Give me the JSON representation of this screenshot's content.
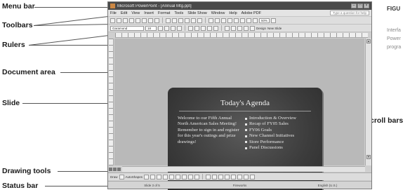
{
  "callouts": {
    "menu_bar": "Menu bar",
    "toolbars": "Toolbars",
    "rulers": "Rulers",
    "document_area": "Document area",
    "slide": "Slide",
    "drawing_tools": "Drawing tools",
    "status_bar": "Status bar",
    "scroll_bars": "Scroll bars"
  },
  "figure": {
    "label": "FIGU",
    "lines": [
      "Interfa",
      "Power",
      "progra"
    ]
  },
  "window": {
    "title": "Microsoft PowerPoint - [Annual Mtg.ppt]",
    "menu": [
      "File",
      "Edit",
      "View",
      "Insert",
      "Format",
      "Tools",
      "Slide Show",
      "Window",
      "Help",
      "Adobe PDF"
    ],
    "help_placeholder": "Type a question for help",
    "font_name": "Garamond",
    "font_size": "18",
    "zoom": "50%",
    "toolbar_text": [
      "Design",
      "New Slide"
    ],
    "drawing_text": [
      "Draw",
      "AutoShapes"
    ],
    "status": [
      "Slide 3 of 5",
      "Fireworks",
      "English (U.S.)"
    ]
  },
  "slide": {
    "title": "Today's Agenda",
    "left_text": [
      "Welcome to our Fifth Annual North American Sales Meeting!",
      "Remember to sign in and register for this year's outings and prize drawings!"
    ],
    "bullets": [
      "Introduction & Overview",
      "Recap of FY05 Sales",
      "FY06 Goals",
      "New Channel Initiatives",
      "Store Performance",
      "Panel Discussions"
    ]
  }
}
